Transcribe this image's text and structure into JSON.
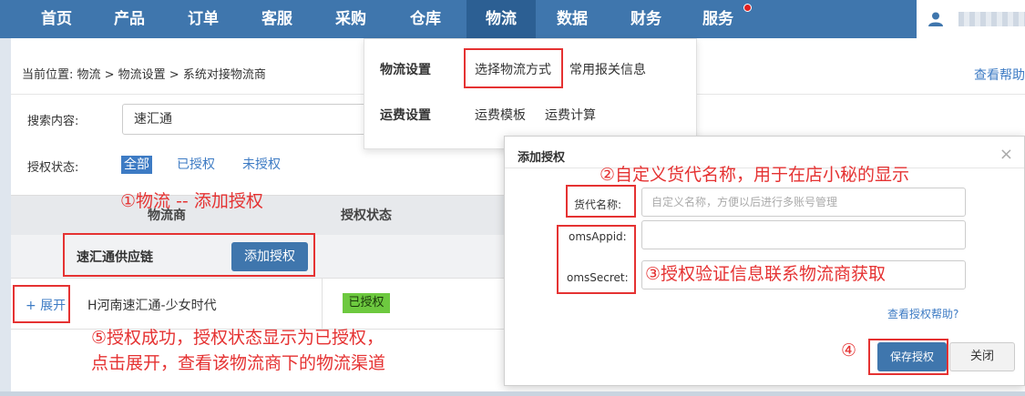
{
  "nav": {
    "items": [
      "首页",
      "产品",
      "订单",
      "客服",
      "采购",
      "仓库",
      "物流",
      "数据",
      "财务",
      "服务"
    ],
    "active_index": 6
  },
  "breadcrumb": {
    "text": "当前位置:  物流 > 物流设置 > 系统对接物流商",
    "help": "查看帮助"
  },
  "search": {
    "label": "搜索内容:",
    "value": "速汇通"
  },
  "auth_filter": {
    "label": "授权状态:",
    "options": [
      "全部",
      "已授权",
      "未授权"
    ],
    "active": "全部"
  },
  "table": {
    "headers": {
      "carrier": "物流商",
      "status": "授权状态"
    },
    "group": {
      "name": "速汇通供应链",
      "add_button": "添加授权"
    },
    "row": {
      "expand": "+ 展开",
      "name": "H河南速汇通-少女时代",
      "status": "已授权"
    }
  },
  "dropdown": {
    "logistics_settings": "物流设置",
    "choose_method": "选择物流方式",
    "customs_info": "常用报关信息",
    "freight_settings": "运费设置",
    "freight_template": "运费模板",
    "freight_calc": "运费计算"
  },
  "modal": {
    "title": "添加授权",
    "close": "×",
    "name_label": "货代名称:",
    "name_placeholder": "自定义名称，方便以后进行多账号管理",
    "appid_label": "omsAppid:",
    "secret_label": "omsSecret:",
    "help_link": "查看授权帮助?",
    "save": "保存授权",
    "cancel": "关闭"
  },
  "annotations": {
    "a1": "①物流 -- 添加授权",
    "a2": "②自定义货代名称，用于在店小秘的显示",
    "a3": "③授权验证信息联系物流商获取",
    "a4": "④",
    "a5_line1": "⑤授权成功，授权状态显示为已授权，",
    "a5_line2": "点击展开，查看该物流商下的物流渠道"
  },
  "colors": {
    "nav_bg": "#3f76ad",
    "annotation_red": "#e53232",
    "badge_green": "#6dc93f",
    "link_blue": "#3d7bc4"
  }
}
